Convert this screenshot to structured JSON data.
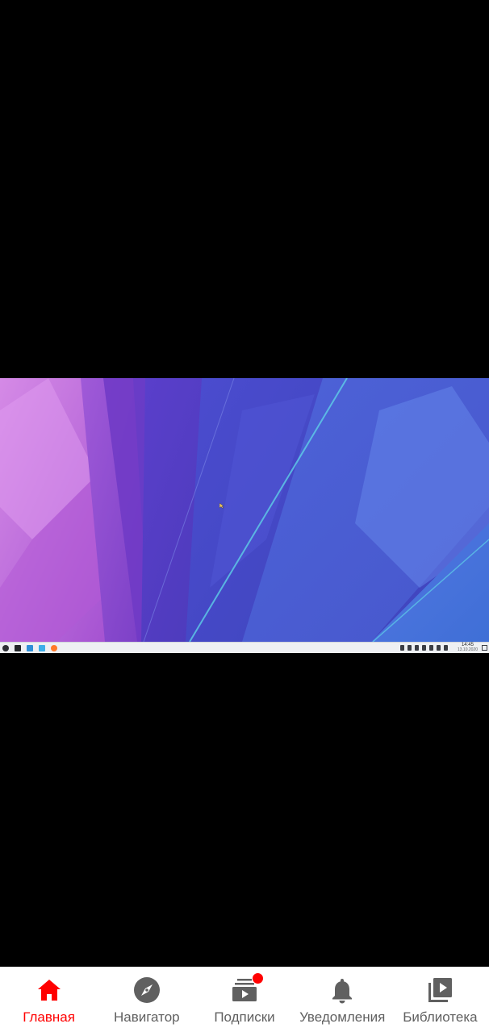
{
  "video": {
    "taskbar": {
      "clock_time": "14:45",
      "clock_date": "13.10.2020"
    }
  },
  "bottom_nav": {
    "active_color": "#ff0000",
    "inactive_color": "#606060",
    "items": [
      {
        "label": "Главная",
        "icon": "home-icon",
        "active": true
      },
      {
        "label": "Навигатор",
        "icon": "compass-icon",
        "active": false
      },
      {
        "label": "Подписки",
        "icon": "subscriptions-icon",
        "active": false,
        "badge": true
      },
      {
        "label": "Уведомления",
        "icon": "bell-icon",
        "active": false
      },
      {
        "label": "Библиотека",
        "icon": "library-icon",
        "active": false
      }
    ]
  }
}
